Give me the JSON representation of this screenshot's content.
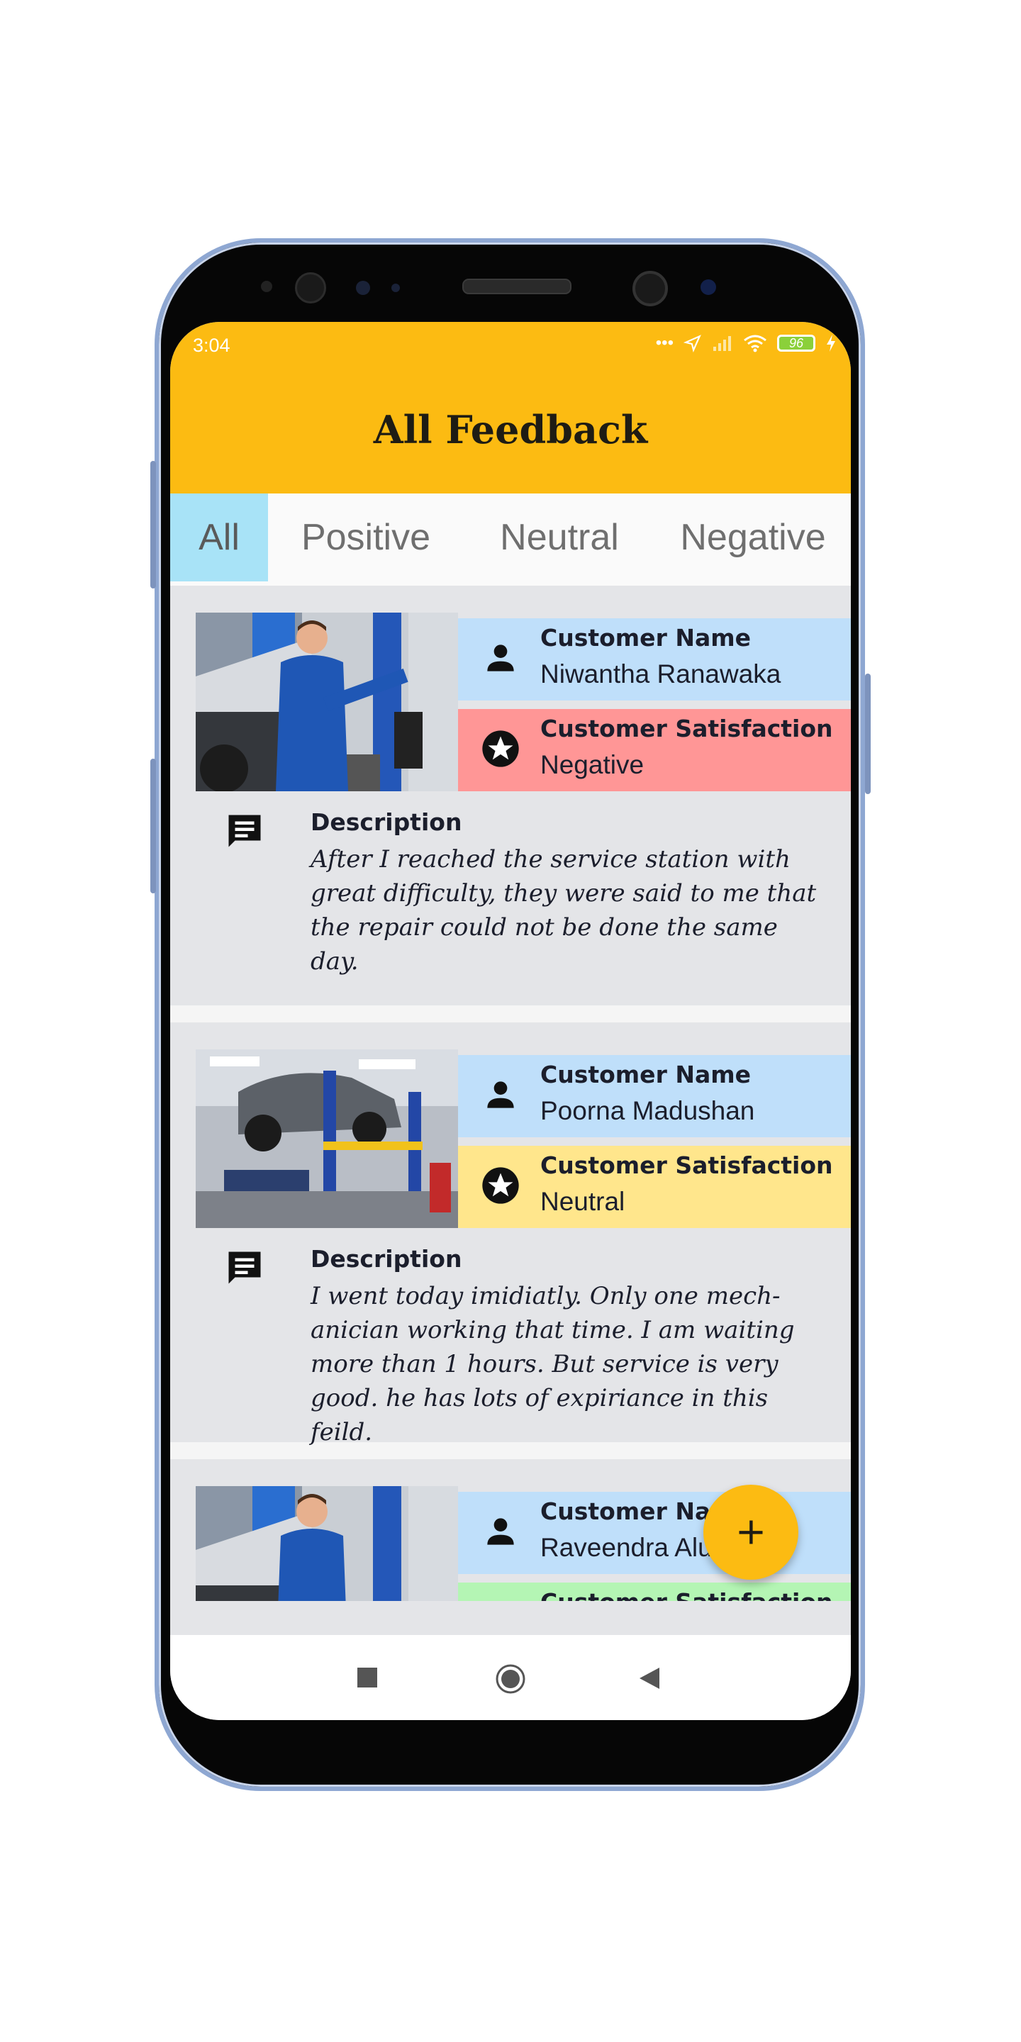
{
  "status_bar": {
    "time": "3:04",
    "battery": "96"
  },
  "app": {
    "title": "All Feedback"
  },
  "tabs": [
    {
      "label": "All",
      "active": true
    },
    {
      "label": "Positive",
      "active": false
    },
    {
      "label": "Neutral",
      "active": false
    },
    {
      "label": "Negative",
      "active": false
    }
  ],
  "cards": [
    {
      "name_label": "Customer Name",
      "name": "Niwantha Ranawaka",
      "satisfaction_label": "Customer Satisfaction",
      "satisfaction": "Negative",
      "satisfaction_color": "#ff9696",
      "description_label": "Description",
      "description": "After I reached the service station with great difficulty, they were said to me that the repair could not be done the same day."
    },
    {
      "name_label": "Customer Name",
      "name": "Poorna Madushan",
      "satisfaction_label": "Customer Satisfaction",
      "satisfaction": "Neutral",
      "satisfaction_color": "#ffe68c",
      "description_label": "Description",
      "description": "I went today imidiatly. Only one mech-anician working that time. I am waiting more than 1 hours. But service is very good. he has lots of expiriance in this feild."
    },
    {
      "name_label": "Customer Name",
      "name": "Raveendra Aluthge",
      "satisfaction_label": "Customer Satisfaction",
      "satisfaction_color": "#b4f5b4"
    }
  ],
  "colors": {
    "accent": "#fcbb12",
    "name_bg": "#bfdffa",
    "tab_active": "#a8e3f7"
  },
  "icons": [
    "person-icon",
    "star-circle-icon",
    "message-icon",
    "add-icon",
    "stop-nav-icon",
    "home-nav-icon",
    "back-nav-icon"
  ]
}
